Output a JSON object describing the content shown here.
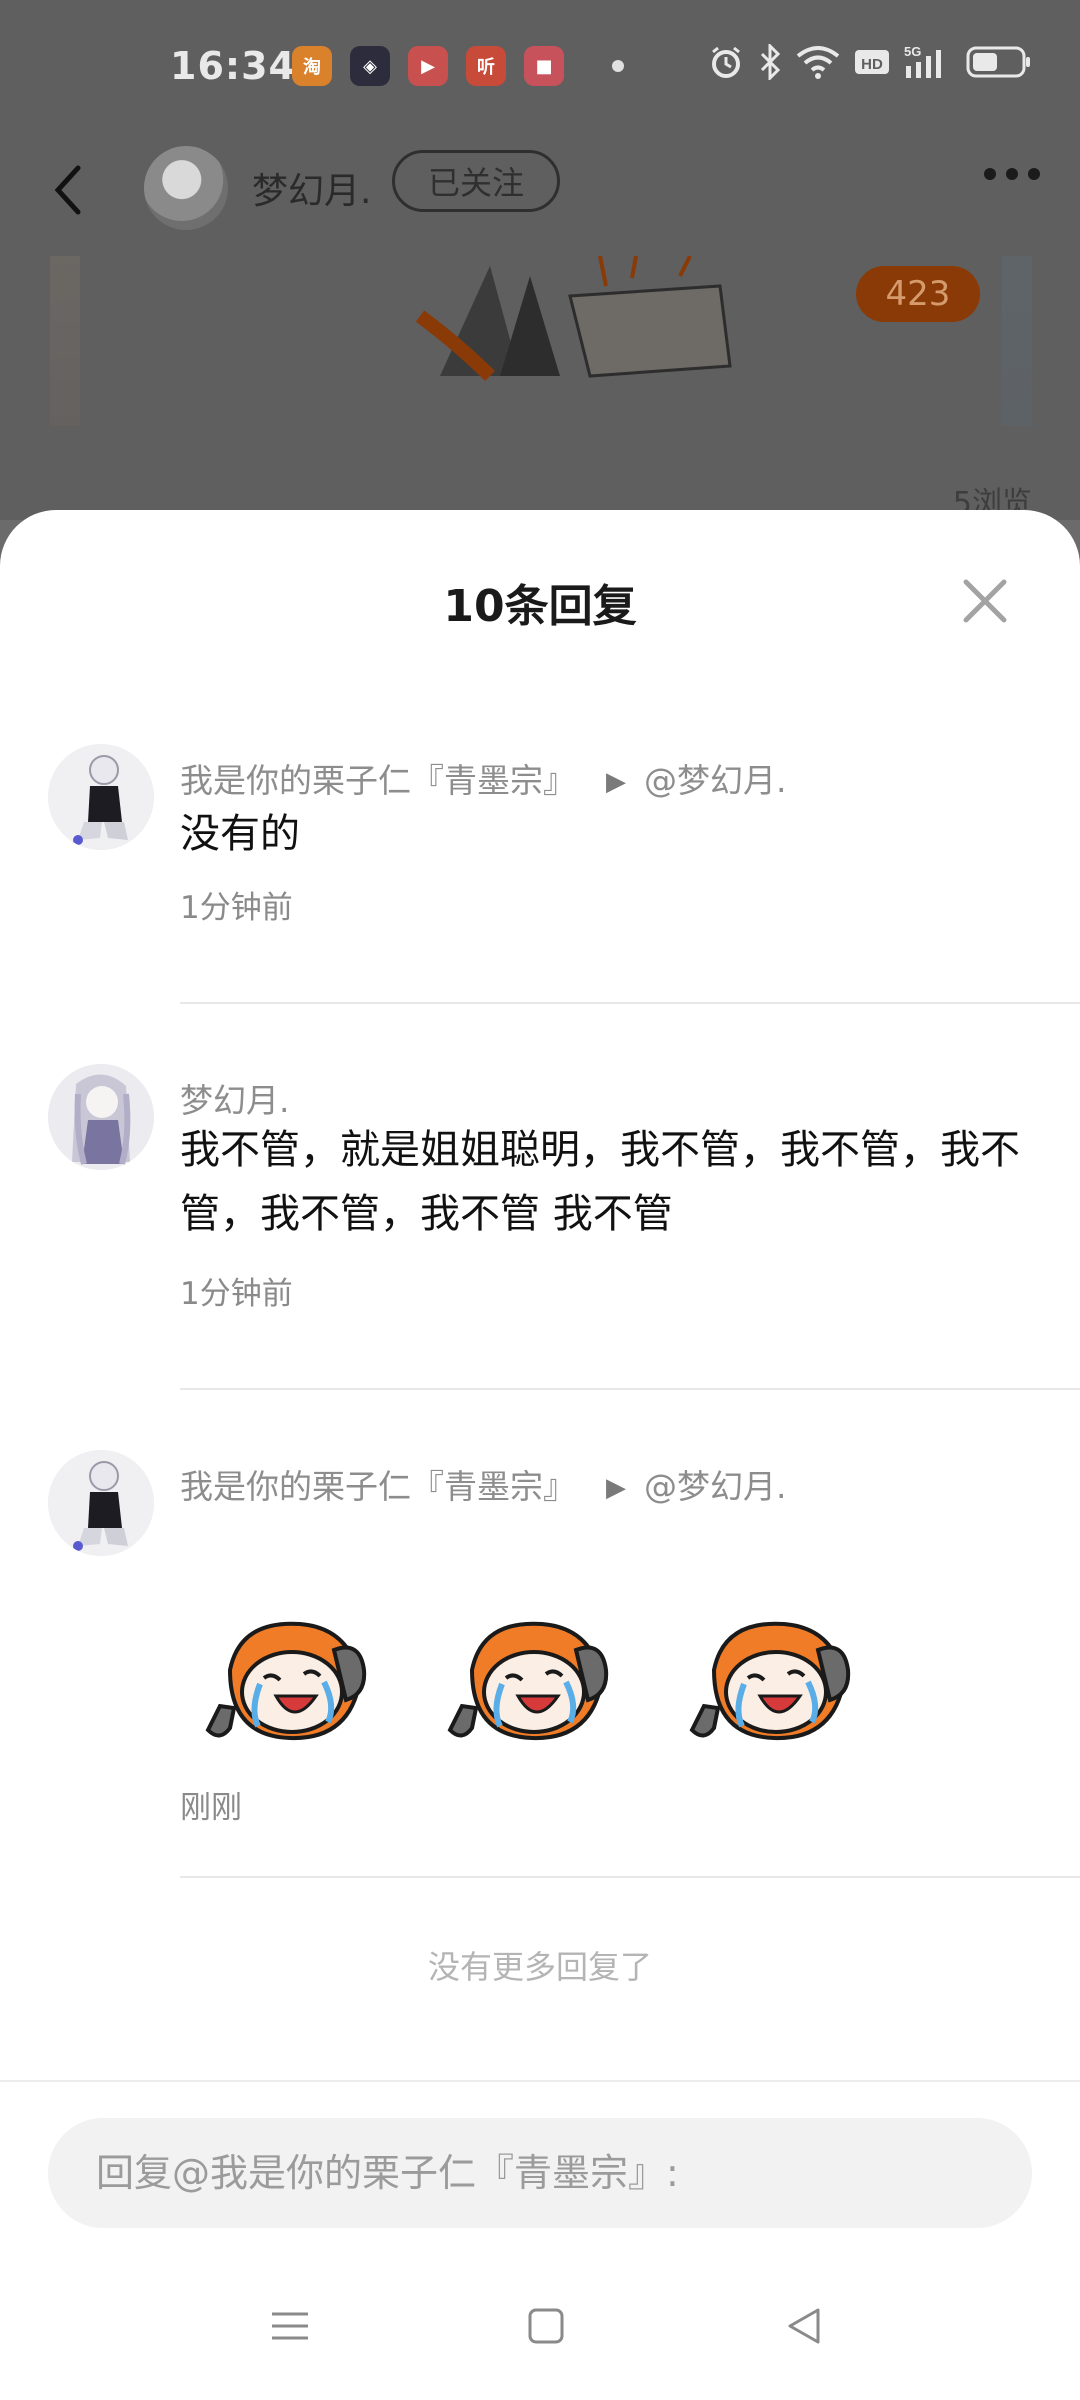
{
  "status_bar": {
    "time": "16:34",
    "app_icons": [
      {
        "name": "taobao-icon",
        "color": "#ff6a00",
        "glyph": "淘"
      },
      {
        "name": "game-icon",
        "color": "#2c2c3c",
        "glyph": "◈"
      },
      {
        "name": "video-icon",
        "color": "#e0273a",
        "glyph": "▶"
      },
      {
        "name": "listen-icon",
        "color": "#e8331e",
        "glyph": "听"
      },
      {
        "name": "record-icon",
        "color": "#e53a4a",
        "glyph": "■"
      }
    ]
  },
  "header": {
    "user_name": "梦幻月.",
    "follow_label": "已关注"
  },
  "background_post": {
    "badge_count": "423",
    "views": "5浏览"
  },
  "sheet": {
    "title": "10条回复"
  },
  "replies": [
    {
      "author": "我是你的栗子仁『青墨宗』",
      "reply_to": "@梦幻月.",
      "text": "没有的",
      "time": "1分钟前"
    },
    {
      "author": "梦幻月.",
      "reply_to": "",
      "text": "我不管，就是姐姐聪明，我不管，我不管，我不管，我不管，我不管 我不管",
      "time": "1分钟前"
    },
    {
      "author": "我是你的栗子仁『青墨宗』",
      "reply_to": "@梦幻月.",
      "text": "",
      "stickers": [
        "laughing-cry-sticker",
        "laughing-cry-sticker",
        "laughing-cry-sticker"
      ],
      "time": "刚刚"
    }
  ],
  "no_more_text": "没有更多回复了",
  "reply_input": {
    "placeholder": "回复@我是你的栗子仁『青墨宗』:"
  },
  "nav": {
    "icons": [
      "menu-icon",
      "home-icon",
      "back-triangle-icon"
    ]
  },
  "colors": {
    "accent_orange": "#f07c28",
    "sheet_background": "#ffffff",
    "dim_overlay": "#5f5f5f"
  }
}
